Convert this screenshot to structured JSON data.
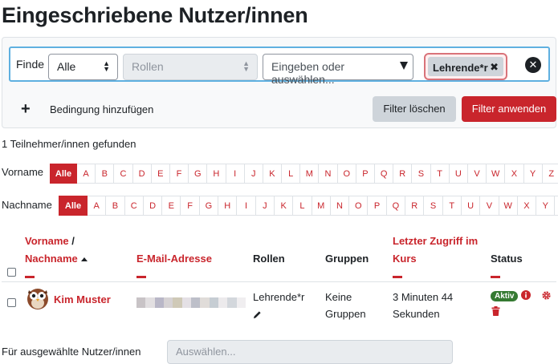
{
  "page": {
    "title": "Eingeschriebene Nutzer/innen"
  },
  "filter": {
    "finde_label": "Finde",
    "join_value": "Alle",
    "type_placeholder": "Rollen",
    "value_placeholder": "Eingeben oder auswählen...",
    "chip_label": "Lehrende*r",
    "chip_remove_symbol": "✖",
    "row_remove_symbol": "✕",
    "add_plus": "+",
    "add_condition": "Bedingung hinzufügen",
    "clear_button": "Filter löschen",
    "apply_button": "Filter anwenden"
  },
  "results": {
    "found_text": "1 Teilnehmer/innen gefunden"
  },
  "initials": {
    "firstname_label": "Vorname",
    "lastname_label": "Nachname",
    "letters": [
      "Alle",
      "A",
      "B",
      "C",
      "D",
      "E",
      "F",
      "G",
      "H",
      "I",
      "J",
      "K",
      "L",
      "M",
      "N",
      "O",
      "P",
      "Q",
      "R",
      "S",
      "T",
      "U",
      "V",
      "W",
      "X",
      "Y",
      "Z"
    ]
  },
  "table": {
    "headers": {
      "firstname": "Vorname",
      "separator": "/",
      "lastname": "Nachname",
      "email": "E-Mail-Adresse",
      "roles": "Rollen",
      "groups": "Gruppen",
      "last_access_1": "Letzter Zugriff im",
      "last_access_2": "Kurs",
      "status": "Status"
    },
    "rows": [
      {
        "name": "Kim Muster",
        "role": "Lehrende*r",
        "groups_1": "Keine",
        "groups_2": "Gruppen",
        "last_access_1": "3 Minuten 44",
        "last_access_2": "Sekunden",
        "status": "Aktiv"
      }
    ]
  },
  "bulk": {
    "label": "Für ausgewählte Nutzer/innen",
    "select_placeholder": "Auswählen..."
  },
  "colors": {
    "brand": "#c9252c",
    "focus": "#5fb0e0",
    "active": "#357a32"
  }
}
